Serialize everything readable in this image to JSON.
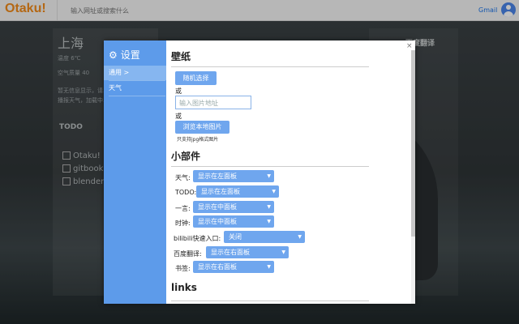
{
  "topbar": {
    "logo": "Otaku!",
    "search_placeholder": "输入网址或搜索什么",
    "gmail": "Gmail",
    "account_icon": "account-circle-icon"
  },
  "background": {
    "city": "上海",
    "temp": "温度 6℃",
    "air": "空气质量 40",
    "line1": "暂无信息显示，请...",
    "line2": "播报天气，加载中...",
    "todo_title": "TODO",
    "todo_items": [
      "Otaku!",
      "gitbook",
      "blender"
    ],
    "translate_label": "百度翻译"
  },
  "modal": {
    "title": "设置",
    "close": "×",
    "nav": [
      {
        "label": "通用 >",
        "active": true
      },
      {
        "label": "天气",
        "active": false
      }
    ],
    "wallpaper": {
      "heading": "壁纸",
      "random_button": "随机选择",
      "or1": "或",
      "url_placeholder": "输入图片地址",
      "or2": "或",
      "browse_button": "浏览本地图片",
      "hint": "只支持jpg格式图片"
    },
    "widgets": {
      "heading": "小部件",
      "rows": [
        {
          "label": "天气:",
          "value": "显示在左面板"
        },
        {
          "label": "TODO:",
          "value": "显示在左面板"
        },
        {
          "label": "一言:",
          "value": "显示在中面板"
        },
        {
          "label": "时钟:",
          "value": "显示在中面板"
        },
        {
          "label": "bilibili快速入口:",
          "value": "关闭"
        },
        {
          "label": "百度翻译:",
          "value": "显示在右面板"
        },
        {
          "label": "书签:",
          "value": "显示在右面板"
        }
      ]
    },
    "links": {
      "heading": "links"
    }
  },
  "colors": {
    "accent": "#5d9bea",
    "button": "#6fa6ee",
    "logo": "#f08a1a"
  }
}
